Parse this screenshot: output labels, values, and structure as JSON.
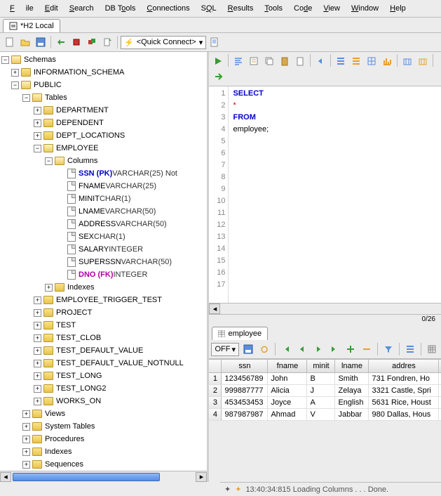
{
  "menu": [
    "File",
    "Edit",
    "Search",
    "DB Tools",
    "Connections",
    "SQL",
    "Results",
    "Tools",
    "Code",
    "View",
    "Window",
    "Help"
  ],
  "tab_title": "*H2 Local",
  "quick_connect": "<Quick Connect>",
  "tree": {
    "root": "Schemas",
    "schemas": [
      {
        "name": "INFORMATION_SCHEMA",
        "open": false
      },
      {
        "name": "PUBLIC",
        "open": true,
        "children": [
          {
            "name": "Tables",
            "open": true,
            "children": [
              {
                "name": "DEPARTMENT"
              },
              {
                "name": "DEPENDENT"
              },
              {
                "name": "DEPT_LOCATIONS"
              },
              {
                "name": "EMPLOYEE",
                "open": true,
                "children": [
                  {
                    "name": "Columns",
                    "open": true,
                    "columns": [
                      {
                        "name": "SSN",
                        "pk": true,
                        "type": "VARCHAR(25) Not"
                      },
                      {
                        "name": "FNAME",
                        "type": "VARCHAR(25)"
                      },
                      {
                        "name": "MINIT",
                        "type": "CHAR(1)"
                      },
                      {
                        "name": "LNAME",
                        "type": "VARCHAR(50)"
                      },
                      {
                        "name": "ADDRESS",
                        "type": "VARCHAR(50)"
                      },
                      {
                        "name": "SEX",
                        "type": "CHAR(1)"
                      },
                      {
                        "name": "SALARY",
                        "type": "INTEGER"
                      },
                      {
                        "name": "SUPERSSN",
                        "type": "VARCHAR(50)"
                      },
                      {
                        "name": "DNO",
                        "fk": true,
                        "type": "INTEGER"
                      }
                    ]
                  },
                  {
                    "name": "Indexes"
                  }
                ]
              },
              {
                "name": "EMPLOYEE_TRIGGER_TEST"
              },
              {
                "name": "PROJECT"
              },
              {
                "name": "TEST"
              },
              {
                "name": "TEST_CLOB"
              },
              {
                "name": "TEST_DEFAULT_VALUE"
              },
              {
                "name": "TEST_DEFAULT_VALUE_NOTNULL"
              },
              {
                "name": "TEST_LONG"
              },
              {
                "name": "TEST_LONG2"
              },
              {
                "name": "WORKS_ON"
              }
            ]
          },
          {
            "name": "Views"
          },
          {
            "name": "System Tables"
          },
          {
            "name": "Procedures"
          },
          {
            "name": "Indexes"
          },
          {
            "name": "Sequences"
          }
        ]
      }
    ]
  },
  "sql": {
    "lines": [
      "SELECT",
      "    *",
      "FROM",
      "    employee;",
      "",
      "",
      "",
      "",
      "",
      "",
      "",
      "",
      "",
      "",
      "",
      "",
      ""
    ],
    "position": "0/26"
  },
  "result_tab": "employee",
  "off_label": "OFF",
  "grid": {
    "headers": [
      "ssn",
      "fname",
      "minit",
      "lname",
      "addres"
    ],
    "rows": [
      [
        "123456789",
        "John",
        "B",
        "Smith",
        "731 Fondren, Ho"
      ],
      [
        "999887777",
        "Alicia",
        "J",
        "Zelaya",
        "3321 Castle, Spri"
      ],
      [
        "453453453",
        "Joyce",
        "A",
        "English",
        "5631 Rice, Houst"
      ],
      [
        "987987987",
        "Ahmad",
        "V",
        "Jabbar",
        "980 Dallas, Hous"
      ]
    ]
  },
  "status_text": "13:40:34:815 Loading Columns . . . Done."
}
